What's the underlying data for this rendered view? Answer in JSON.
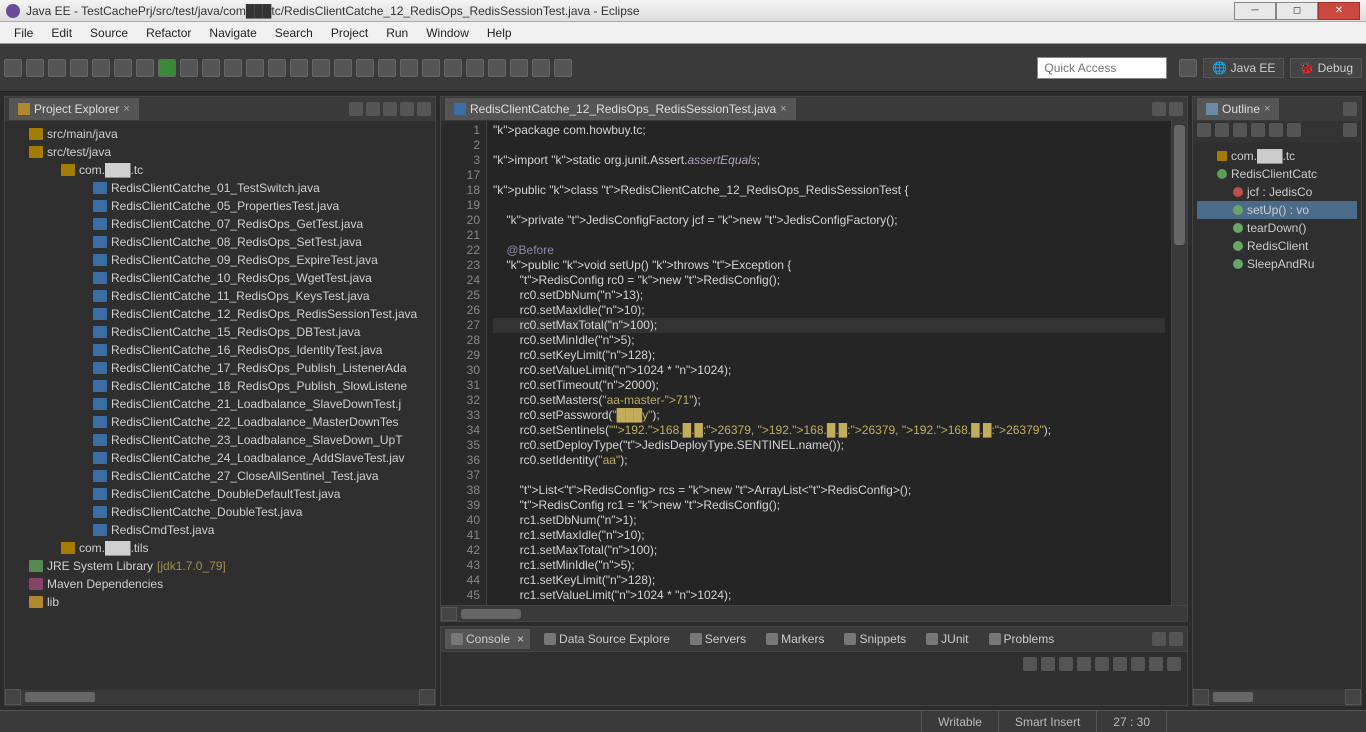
{
  "window": {
    "title": "Java EE - TestCachePrj/src/test/java/com███tc/RedisClientCatche_12_RedisOps_RedisSessionTest.java - Eclipse"
  },
  "menu": [
    "File",
    "Edit",
    "Source",
    "Refactor",
    "Navigate",
    "Search",
    "Project",
    "Run",
    "Window",
    "Help"
  ],
  "quick_access_placeholder": "Quick Access",
  "perspectives": [
    "Java EE",
    "Debug"
  ],
  "project_explorer": {
    "title": "Project Explorer",
    "items": [
      {
        "depth": "d1",
        "icon": "p",
        "label": "src/main/java"
      },
      {
        "depth": "d1",
        "icon": "p",
        "label": "src/test/java"
      },
      {
        "depth": "d2",
        "icon": "p",
        "label": "com.███.tc"
      },
      {
        "depth": "d3",
        "icon": "j",
        "label": "RedisClientCatche_01_TestSwitch.java"
      },
      {
        "depth": "d3",
        "icon": "j",
        "label": "RedisClientCatche_05_PropertiesTest.java"
      },
      {
        "depth": "d3",
        "icon": "j",
        "label": "RedisClientCatche_07_RedisOps_GetTest.java"
      },
      {
        "depth": "d3",
        "icon": "j",
        "label": "RedisClientCatche_08_RedisOps_SetTest.java"
      },
      {
        "depth": "d3",
        "icon": "j",
        "label": "RedisClientCatche_09_RedisOps_ExpireTest.java"
      },
      {
        "depth": "d3",
        "icon": "j",
        "label": "RedisClientCatche_10_RedisOps_WgetTest.java"
      },
      {
        "depth": "d3",
        "icon": "j",
        "label": "RedisClientCatche_11_RedisOps_KeysTest.java"
      },
      {
        "depth": "d3",
        "icon": "j",
        "label": "RedisClientCatche_12_RedisOps_RedisSessionTest.java"
      },
      {
        "depth": "d3",
        "icon": "j",
        "label": "RedisClientCatche_15_RedisOps_DBTest.java"
      },
      {
        "depth": "d3",
        "icon": "j",
        "label": "RedisClientCatche_16_RedisOps_IdentityTest.java"
      },
      {
        "depth": "d3",
        "icon": "j",
        "label": "RedisClientCatche_17_RedisOps_Publish_ListenerAda"
      },
      {
        "depth": "d3",
        "icon": "j",
        "label": "RedisClientCatche_18_RedisOps_Publish_SlowListene"
      },
      {
        "depth": "d3",
        "icon": "j",
        "label": "RedisClientCatche_21_Loadbalance_SlaveDownTest.j"
      },
      {
        "depth": "d3",
        "icon": "j",
        "label": "RedisClientCatche_22_Loadbalance_MasterDownTes"
      },
      {
        "depth": "d3",
        "icon": "j",
        "label": "RedisClientCatche_23_Loadbalance_SlaveDown_UpT"
      },
      {
        "depth": "d3",
        "icon": "j",
        "label": "RedisClientCatche_24_Loadbalance_AddSlaveTest.jav"
      },
      {
        "depth": "d3",
        "icon": "j",
        "label": "RedisClientCatche_27_CloseAllSentinel_Test.java"
      },
      {
        "depth": "d3",
        "icon": "j",
        "label": "RedisClientCatche_DoubleDefaultTest.java"
      },
      {
        "depth": "d3",
        "icon": "j",
        "label": "RedisClientCatche_DoubleTest.java"
      },
      {
        "depth": "d3",
        "icon": "j",
        "label": "RedisCmdTest.java"
      },
      {
        "depth": "d2",
        "icon": "p",
        "label": "com.███.tils"
      },
      {
        "depth": "d1",
        "icon": "l",
        "label": "JRE System Library",
        "suffix": "[jdk1.7.0_79]"
      },
      {
        "depth": "d1",
        "icon": "m",
        "label": "Maven Dependencies"
      },
      {
        "depth": "d1",
        "icon": "",
        "label": "lib"
      }
    ]
  },
  "editor": {
    "tab_title": "RedisClientCatche_12_RedisOps_RedisSessionTest.java",
    "line_start_a": [
      1,
      2,
      3,
      17,
      18,
      19,
      20,
      21,
      22,
      23,
      24,
      25,
      26,
      27,
      28,
      29,
      30,
      31,
      32,
      33,
      34,
      35,
      36,
      37,
      38,
      39,
      40,
      41,
      42,
      43,
      44,
      45
    ]
  },
  "code": {
    "l1": "package com.howbuy.tc;",
    "l2": "",
    "l3": "import static org.junit.Assert.assertEquals;",
    "l17": "",
    "l18": "public class RedisClientCatche_12_RedisOps_RedisSessionTest {",
    "l19": "",
    "l20": "    private JedisConfigFactory jcf = new JedisConfigFactory();",
    "l21": "",
    "l22": "    @Before",
    "l23": "    public void setUp() throws Exception {",
    "l24": "        RedisConfig rc0 = new RedisConfig();",
    "l25": "        rc0.setDbNum(13);",
    "l26": "        rc0.setMaxIdle(10);",
    "l27": "        rc0.setMaxTotal(100);",
    "l28": "        rc0.setMinIdle(5);",
    "l29": "        rc0.setKeyLimit(128);",
    "l30": "        rc0.setValueLimit(1024 * 1024);",
    "l31": "        rc0.setTimeout(2000);",
    "l32": "        rc0.setMasters(\"aa-master-71\");",
    "l33": "        rc0.setPassword(\"███y\");",
    "l34": "        rc0.setSentinels(\"192.168.█.█:26379, 192.168.█.█:26379, 192.168.█.█:26379\");",
    "l35": "        rc0.setDeployType(JedisDeployType.SENTINEL.name());",
    "l36": "        rc0.setIdentity(\"aa\");",
    "l37": "",
    "l38": "        List<RedisConfig> rcs = new ArrayList<RedisConfig>();",
    "l39": "        RedisConfig rc1 = new RedisConfig();",
    "l40": "        rc1.setDbNum(1);",
    "l41": "        rc1.setMaxIdle(10);",
    "l42": "        rc1.setMaxTotal(100);",
    "l43": "        rc1.setMinIdle(5);",
    "l44": "        rc1.setKeyLimit(128);",
    "l45": "        rc1.setValueLimit(1024 * 1024);"
  },
  "bottom_tabs": [
    "Console",
    "Data Source Explore",
    "Servers",
    "Markers",
    "Snippets",
    "JUnit",
    "Problems"
  ],
  "outline": {
    "title": "Outline",
    "items": [
      {
        "depth": "",
        "icon": "pkg",
        "label": "com.███.tc"
      },
      {
        "depth": "",
        "icon": "cls",
        "label": "RedisClientCatc"
      },
      {
        "depth": "d2",
        "icon": "fld",
        "label": "jcf : JedisCo"
      },
      {
        "depth": "d2",
        "icon": "mth",
        "label": "setUp() : vo",
        "sel": true
      },
      {
        "depth": "d2",
        "icon": "mth",
        "label": "tearDown()"
      },
      {
        "depth": "d2",
        "icon": "mth",
        "label": "RedisClient"
      },
      {
        "depth": "d2",
        "icon": "mth",
        "label": "SleepAndRu"
      }
    ]
  },
  "status": {
    "writable": "Writable",
    "insert": "Smart Insert",
    "pos": "27 : 30"
  }
}
